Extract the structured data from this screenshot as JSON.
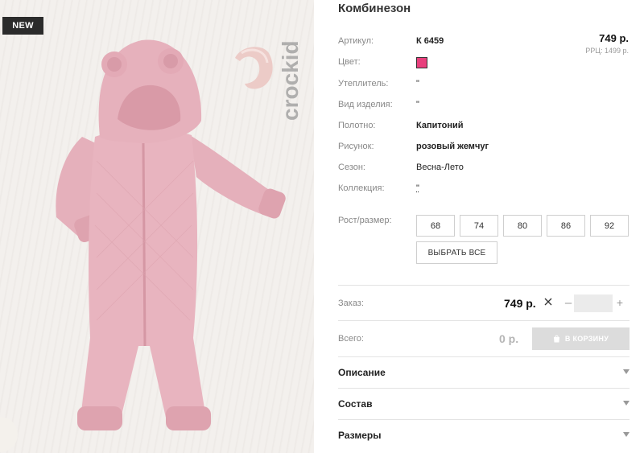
{
  "badge": "NEW",
  "watermark": "crockid",
  "product": {
    "title": "Комбинезон",
    "price": "749 р.",
    "rrc": "РРЦ: 1499 р.",
    "swatch_color": "#e8407d"
  },
  "attributes": [
    {
      "label": "Артикул:",
      "value": "К 6459"
    },
    {
      "label": "Цвет:",
      "value": ""
    },
    {
      "label": "Утеплитель:",
      "value": "\""
    },
    {
      "label": "Вид изделия:",
      "value": "\""
    },
    {
      "label": "Полотно:",
      "value": "Капитоний"
    },
    {
      "label": "Рисунок:",
      "value": "розовый жемчуг"
    },
    {
      "label": "Сезон:",
      "value": "Весна-Лето"
    },
    {
      "label": "Коллекция:",
      "value": "\""
    }
  ],
  "sizes": {
    "label": "Рост/размер:",
    "options": [
      "68",
      "74",
      "80",
      "86",
      "92"
    ],
    "select_all": "ВЫБРАТЬ ВСЕ"
  },
  "order": {
    "label": "Заказ:",
    "price": "749 р.",
    "minus": "–",
    "plus": "+",
    "quantity": ""
  },
  "total": {
    "label": "Всего:",
    "value": "0 р.",
    "cart_button": "В КОРЗИНУ"
  },
  "accordion": [
    {
      "label": "Описание"
    },
    {
      "label": "Состав"
    },
    {
      "label": "Размеры"
    }
  ],
  "colors": {
    "divider": "#e3e3e3",
    "product_pink": "#e9b3be",
    "cart_disabled": "#dcdcdc"
  },
  "icons": {
    "times": "times-icon",
    "cart": "bag-icon",
    "accordion_arrow": "caret-down-icon"
  }
}
